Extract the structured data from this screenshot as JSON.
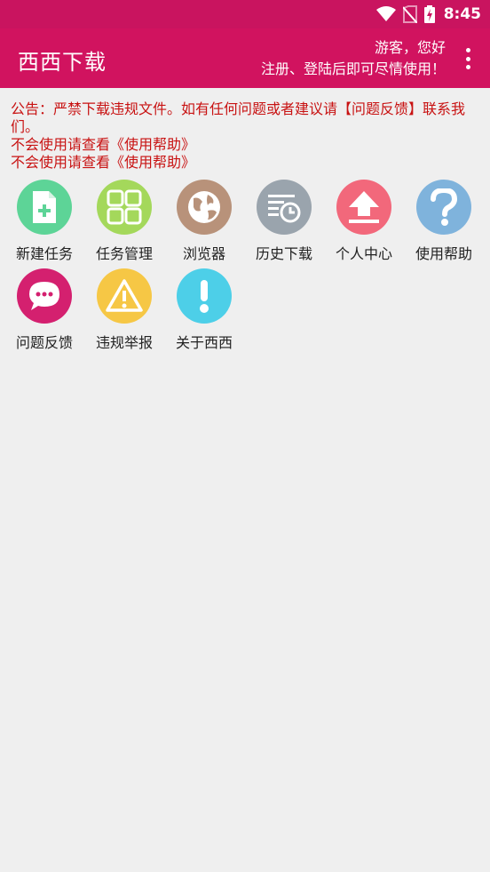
{
  "status": {
    "time": "8:45",
    "icons": [
      "wifi-icon",
      "no-sim-icon",
      "battery-charging-icon"
    ]
  },
  "appbar": {
    "title": "西西下载",
    "greeting": "游客，您好",
    "hint": "注册、登陆后即可尽情使用！",
    "menu_icon": "more-vert-icon"
  },
  "notice": {
    "line1": "公告：严禁下载违规文件。如有任何问题或者建议请【问题反馈】联系我们。",
    "line2": "不会使用请查看《使用帮助》",
    "line3": "不会使用请查看《使用帮助》"
  },
  "grid": {
    "items": [
      {
        "label": "新建任务",
        "icon": "new-file-icon",
        "color": "#5dd497"
      },
      {
        "label": "任务管理",
        "icon": "grid-icon",
        "color": "#a4d85b"
      },
      {
        "label": "浏览器",
        "icon": "globe-icon",
        "color": "#b8927a"
      },
      {
        "label": "历史下载",
        "icon": "history-icon",
        "color": "#9aa4ad"
      },
      {
        "label": "个人中心",
        "icon": "upload-icon",
        "color": "#f2687b"
      },
      {
        "label": "使用帮助",
        "icon": "question-icon",
        "color": "#7fb3dc"
      },
      {
        "label": "问题反馈",
        "icon": "chat-icon",
        "color": "#d4206f"
      },
      {
        "label": "违规举报",
        "icon": "warning-icon",
        "color": "#f6c745"
      },
      {
        "label": "关于西西",
        "icon": "info-icon",
        "color": "#4dcfe8"
      }
    ]
  }
}
